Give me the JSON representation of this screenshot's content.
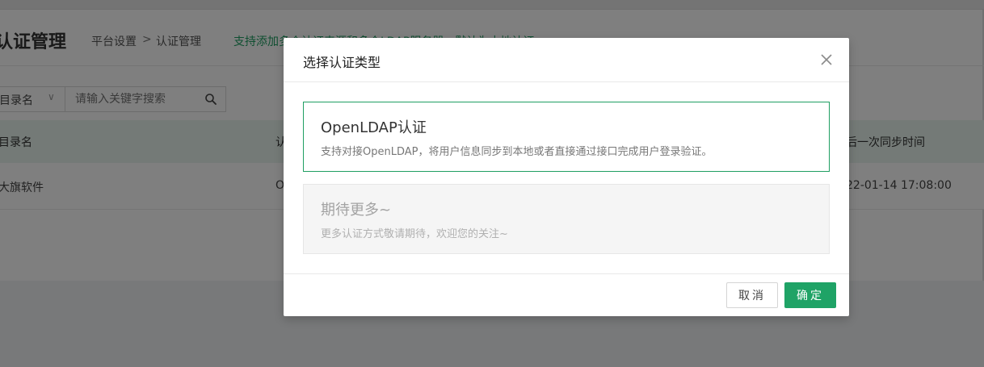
{
  "page": {
    "title": "认证管理",
    "breadcrumb": [
      "平台设置",
      "认证管理"
    ],
    "breadcrumb_separator": ">",
    "tip": "支持添加多个认证来源和多个LDAP服务器，默认为本地认证"
  },
  "filter": {
    "select_value": "目录名",
    "search_placeholder": "请输入关键字搜索"
  },
  "table": {
    "columns": [
      "目录名",
      "认",
      "后一次同步时间"
    ],
    "rows": [
      [
        "大旗软件",
        "O",
        "22-01-14 17:08:00"
      ]
    ]
  },
  "modal": {
    "title": "选择认证类型",
    "options": [
      {
        "title": "OpenLDAP认证",
        "description": "支持对接OpenLDAP，将用户信息同步到本地或者直接通过接口完成用户登录验证。",
        "selected": true
      },
      {
        "title": "期待更多~",
        "description": "更多认证方式敬请期待，欢迎您的关注~",
        "selected": false
      }
    ],
    "cancel_label": "取消",
    "ok_label": "确定"
  },
  "colors": {
    "accent": "#1fa366",
    "table_header_bg": "#e8f5ee",
    "overlay": "rgba(0,0,0,0.5)"
  },
  "icons": {
    "search": "search-icon",
    "close": "close-icon",
    "chevron": "chevron-down-icon"
  }
}
